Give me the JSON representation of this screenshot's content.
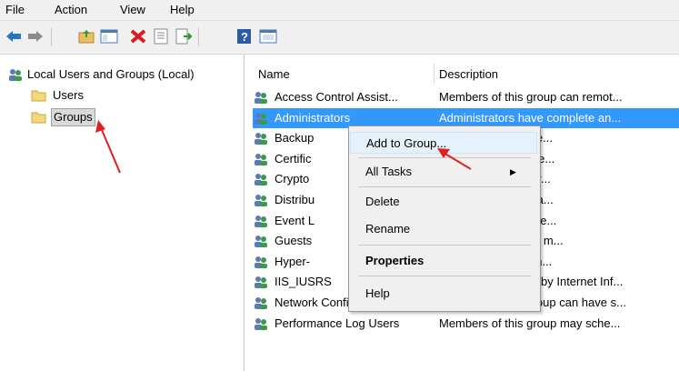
{
  "menu": [
    "File",
    "Action",
    "View",
    "Help"
  ],
  "toolbar_icons": [
    "back-arrow-icon",
    "forward-arrow-icon",
    "up-folder-icon",
    "console-tree-icon",
    "delete-icon",
    "properties-icon",
    "export-icon",
    "help-icon",
    "mmc-view-icon"
  ],
  "tree": {
    "root": "Local Users and Groups (Local)",
    "users": "Users",
    "groups": "Groups"
  },
  "columns": {
    "name": "Name",
    "description": "Description"
  },
  "rows": [
    {
      "name": "Access Control Assist...",
      "description": "Members of this group can remot..."
    },
    {
      "name": "Administrators",
      "description": "Administrators have complete an..."
    },
    {
      "name": "Backup",
      "description": "tors can override se..."
    },
    {
      "name": "Certific",
      "description": "his group are allowe..."
    },
    {
      "name": "Crypto",
      "description": "authorized to perfor..."
    },
    {
      "name": "Distribu",
      "description": "allowed to launch, a..."
    },
    {
      "name": "Event L",
      "description": "his group can read e..."
    },
    {
      "name": "Guests",
      "description": "he same access as m..."
    },
    {
      "name": "Hyper-",
      "description": "his group have com..."
    },
    {
      "name": "IIS_IUSRS",
      "description": "Built-in group used by Internet Inf..."
    },
    {
      "name": "Network Configuratio...",
      "description": "Members in this group can have s..."
    },
    {
      "name": "Performance Log Users",
      "description": "Members of this group may sche..."
    }
  ],
  "context_menu": {
    "add_to_group": "Add to Group...",
    "all_tasks": "All Tasks",
    "delete": "Delete",
    "rename": "Rename",
    "properties": "Properties",
    "help": "Help"
  },
  "colors": {
    "selection": "#3399ff",
    "annotation_arrow": "#e02020",
    "menu_bg": "#f0f0f0"
  }
}
